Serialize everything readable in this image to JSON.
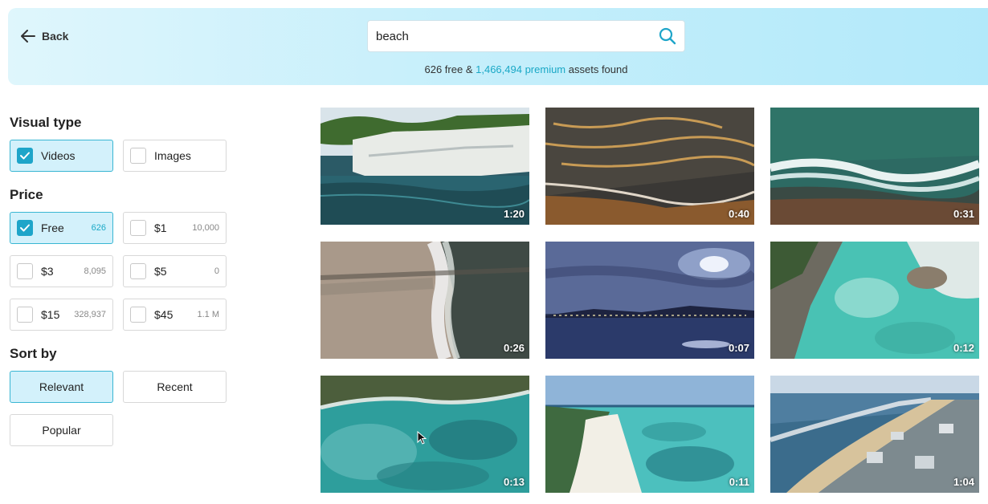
{
  "header": {
    "back_label": "Back",
    "search_value": "beach",
    "results": {
      "free_count": "626 free",
      "amp": "&",
      "premium_count": "1,466,494 premium",
      "suffix": "assets found"
    }
  },
  "sidebar": {
    "visual_type": {
      "title": "Visual type",
      "options": [
        {
          "label": "Videos",
          "checked": true
        },
        {
          "label": "Images",
          "checked": false
        }
      ]
    },
    "price": {
      "title": "Price",
      "options": [
        {
          "label": "Free",
          "count": "626",
          "checked": true
        },
        {
          "label": "$1",
          "count": "10,000",
          "checked": false
        },
        {
          "label": "$3",
          "count": "8,095",
          "checked": false
        },
        {
          "label": "$5",
          "count": "0",
          "checked": false
        },
        {
          "label": "$15",
          "count": "328,937",
          "checked": false
        },
        {
          "label": "$45",
          "count": "1.1 M",
          "checked": false
        }
      ]
    },
    "sort": {
      "title": "Sort by",
      "options": [
        {
          "label": "Relevant",
          "active": true
        },
        {
          "label": "Recent",
          "active": false
        },
        {
          "label": "Popular",
          "active": false
        }
      ]
    }
  },
  "grid": {
    "items": [
      {
        "duration": "1:20",
        "scene": "cliff-sea"
      },
      {
        "duration": "0:40",
        "scene": "sunset-wave"
      },
      {
        "duration": "0:31",
        "scene": "aerial-wave"
      },
      {
        "duration": "0:26",
        "scene": "aerial-shore"
      },
      {
        "duration": "0:07",
        "scene": "moon-night"
      },
      {
        "duration": "0:12",
        "scene": "rocky-lagoon"
      },
      {
        "duration": "0:13",
        "scene": "turquoise-cove"
      },
      {
        "duration": "0:11",
        "scene": "white-beach"
      },
      {
        "duration": "1:04",
        "scene": "coastal-town"
      }
    ]
  },
  "colors": {
    "accent": "#1ea5c9",
    "active_bg": "#d3f1fb",
    "premium_link": "#1aa8c6"
  }
}
